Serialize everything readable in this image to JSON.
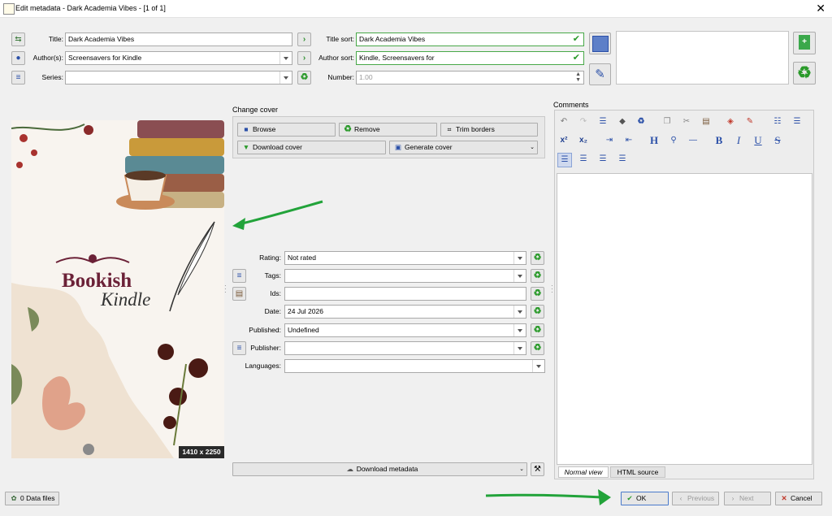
{
  "window": {
    "title": "Edit metadata - Dark Academia Vibes - [1 of 1]",
    "close_glyph": "✕"
  },
  "fields": {
    "title": {
      "label": "Title:",
      "value": "Dark Academia Vibes"
    },
    "title_sort": {
      "label": "Title sort:",
      "value": "Dark Academia Vibes"
    },
    "authors": {
      "label": "Author(s):",
      "value": "Screensavers for Kindle"
    },
    "author_sort": {
      "label": "Author sort:",
      "value": "Kindle, Screensavers for"
    },
    "series": {
      "label": "Series:",
      "value": ""
    },
    "number": {
      "label": "Number:",
      "value": "1.00"
    }
  },
  "cover": {
    "change_label": "Change cover",
    "browse": "Browse",
    "remove": "Remove",
    "trim": "Trim borders",
    "download": "Download cover",
    "generate": "Generate cover",
    "dimensions": "1410 x 2250",
    "art_title_1": "Bookish",
    "art_title_2": "Kindle"
  },
  "meta": {
    "rating": {
      "label": "Rating:",
      "value": "Not rated"
    },
    "tags": {
      "label": "Tags:",
      "value": ""
    },
    "ids": {
      "label": "Ids:",
      "value": ""
    },
    "date": {
      "label": "Date:",
      "value": "24 Jul 2026"
    },
    "published": {
      "label": "Published:",
      "value": "Undefined"
    },
    "publisher": {
      "label": "Publisher:",
      "value": ""
    },
    "languages": {
      "label": "Languages:",
      "value": ""
    },
    "download_metadata": "Download metadata"
  },
  "comments": {
    "label": "Comments",
    "tab_normal": "Normal view",
    "tab_html": "HTML source"
  },
  "bottom": {
    "data_files": "0 Data files",
    "ok": "OK",
    "previous": "Previous",
    "next": "Next",
    "cancel": "Cancel"
  },
  "colors": {
    "annotation_arrow": "#22a33a",
    "field_ok_border": "#48a848",
    "cover_title": "#6b2137"
  }
}
